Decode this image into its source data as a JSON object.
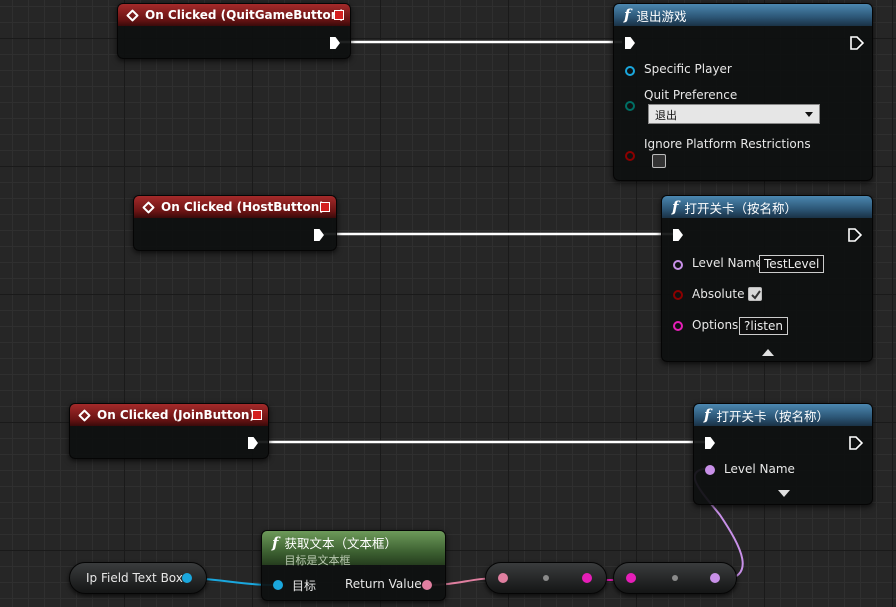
{
  "nodes": {
    "quit_event": {
      "title": "On Clicked (QuitGameButton)"
    },
    "host_event": {
      "title": "On Clicked (HostButton)"
    },
    "join_event": {
      "title": "On Clicked (JoinButton)"
    },
    "quit_game": {
      "title": "退出游戏",
      "pins": {
        "specific_player": "Specific Player",
        "quit_preference": "Quit Preference",
        "quit_preference_value": "退出",
        "ignore_platform": "Ignore Platform Restrictions"
      }
    },
    "open_level_host": {
      "title": "打开关卡（按名称）",
      "pins": {
        "level_name": "Level Name",
        "level_name_value": "TestLevel",
        "absolute": "Absolute",
        "options": "Options",
        "options_value": "?listen"
      }
    },
    "open_level_join": {
      "title": "打开关卡（按名称）",
      "pins": {
        "level_name": "Level Name"
      }
    },
    "get_text": {
      "title": "获取文本（文本框）",
      "subtitle": "目标是文本框",
      "pins": {
        "target": "目标",
        "return_value": "Return Value"
      }
    },
    "ip_field": {
      "label": "Ip Field Text Box"
    }
  },
  "colors": {
    "exec_wire": "#ffffff",
    "object_pin": "#1aa7dd",
    "text_pin": "#e07fa0",
    "string_pin": "#e61eb8",
    "name_pin": "#c890e8",
    "bool_pin": "#8c0000",
    "byte_pin": "#006f65"
  }
}
